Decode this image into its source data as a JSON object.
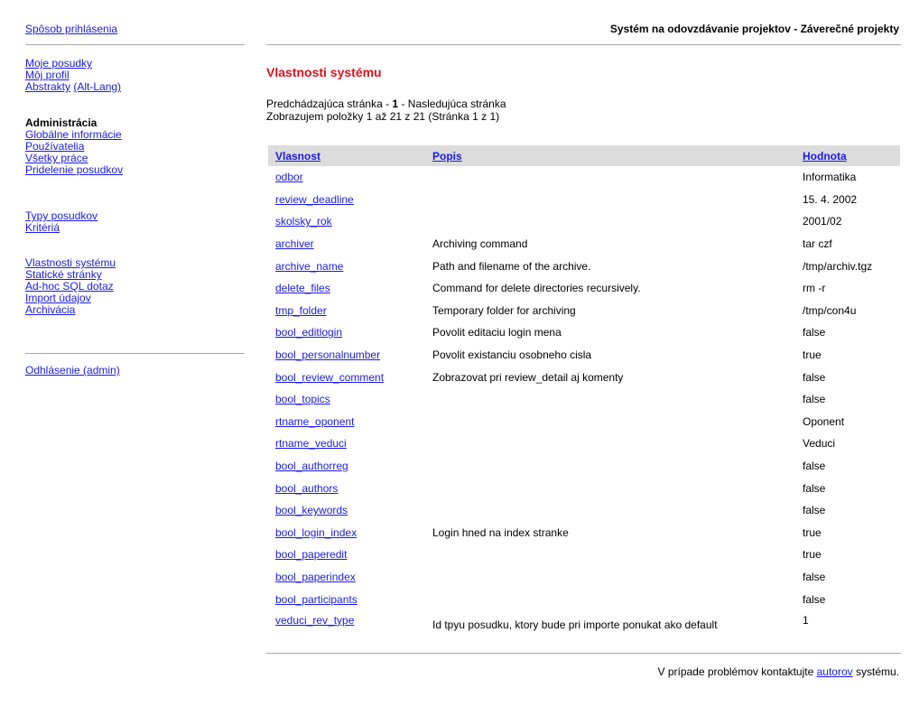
{
  "sidebar": {
    "login_method": "Spôsob prihlásenia",
    "user_links": [
      {
        "label": "Moje posudky"
      },
      {
        "label": "Môj profil"
      },
      {
        "label": "Abstrakty"
      },
      {
        "label": "(Alt-Lang)"
      }
    ],
    "admin_heading": "Administrácia",
    "admin_links": [
      {
        "label": "Globálne informácie"
      },
      {
        "label": "Používatelia"
      },
      {
        "label": "Všetky práce"
      },
      {
        "label": "Pridelenie posudkov"
      }
    ],
    "review_links": [
      {
        "label": "Typy posudkov"
      },
      {
        "label": "Kritériá"
      }
    ],
    "system_links": [
      {
        "label": "Vlastnosti systému"
      },
      {
        "label": "Statické stránky"
      },
      {
        "label": "Ad-hoc SQL dotaz"
      },
      {
        "label": "Import údajov"
      },
      {
        "label": "Archivácia"
      }
    ],
    "logout": "Odhlásenie (admin)"
  },
  "header": {
    "title": "Systém na odovzdávanie projektov - Záverečné projekty"
  },
  "main": {
    "page_title": "Vlastnosti systému",
    "pager": {
      "prev": "Predchádzajúca stránka",
      "sep1": " - ",
      "current": "1",
      "sep2": " - ",
      "next": "Nasledujúca stránka",
      "summary": "Zobrazujem položky 1 až 21 z 21 (Stránka 1 z 1)"
    },
    "table": {
      "headers": {
        "name": "Vlasnost",
        "desc": "Popis",
        "value": "Hodnota"
      },
      "rows": [
        {
          "name": "odbor",
          "desc": "",
          "value": "Informatika"
        },
        {
          "name": "review_deadline",
          "desc": "",
          "value": "15. 4. 2002"
        },
        {
          "name": "skolsky_rok",
          "desc": "",
          "value": "2001/02"
        },
        {
          "name": "archiver",
          "desc": "Archiving command",
          "value": "tar czf"
        },
        {
          "name": "archive_name",
          "desc": "Path and filename of the archive.",
          "value": "/tmp/archiv.tgz"
        },
        {
          "name": "delete_files",
          "desc": "Command for delete directories recursively.",
          "value": "rm -r"
        },
        {
          "name": "tmp_folder",
          "desc": "Temporary folder for archiving",
          "value": "/tmp/con4u"
        },
        {
          "name": "bool_editlogin",
          "desc": "Povolit editaciu login mena",
          "value": "false"
        },
        {
          "name": "bool_personalnumber",
          "desc": "Povolit existanciu osobneho cisla",
          "value": "true"
        },
        {
          "name": "bool_review_comment",
          "desc": "Zobrazovat pri review_detail aj komenty",
          "value": "false"
        },
        {
          "name": "bool_topics",
          "desc": "",
          "value": "false"
        },
        {
          "name": "rtname_oponent",
          "desc": "",
          "value": "Oponent"
        },
        {
          "name": "rtname_veduci",
          "desc": "",
          "value": "Veduci"
        },
        {
          "name": "bool_authorreg",
          "desc": "",
          "value": "false"
        },
        {
          "name": "bool_authors",
          "desc": "",
          "value": "false"
        },
        {
          "name": "bool_keywords",
          "desc": "",
          "value": "false"
        },
        {
          "name": "bool_login_index",
          "desc": "Login hned na index stranke",
          "value": "true"
        },
        {
          "name": "bool_paperedit",
          "desc": "",
          "value": "true"
        },
        {
          "name": "bool_paperindex",
          "desc": "",
          "value": "false"
        },
        {
          "name": "bool_participants",
          "desc": "",
          "value": "false"
        },
        {
          "name": "veduci_rev_type",
          "desc": "Id tpyu posudku, ktory bude pri importe ponukat ako default",
          "value": "1"
        }
      ]
    }
  },
  "footer": {
    "prefix": "V prípade problémov kontaktujte",
    "link": "autorov",
    "suffix": "systému."
  }
}
